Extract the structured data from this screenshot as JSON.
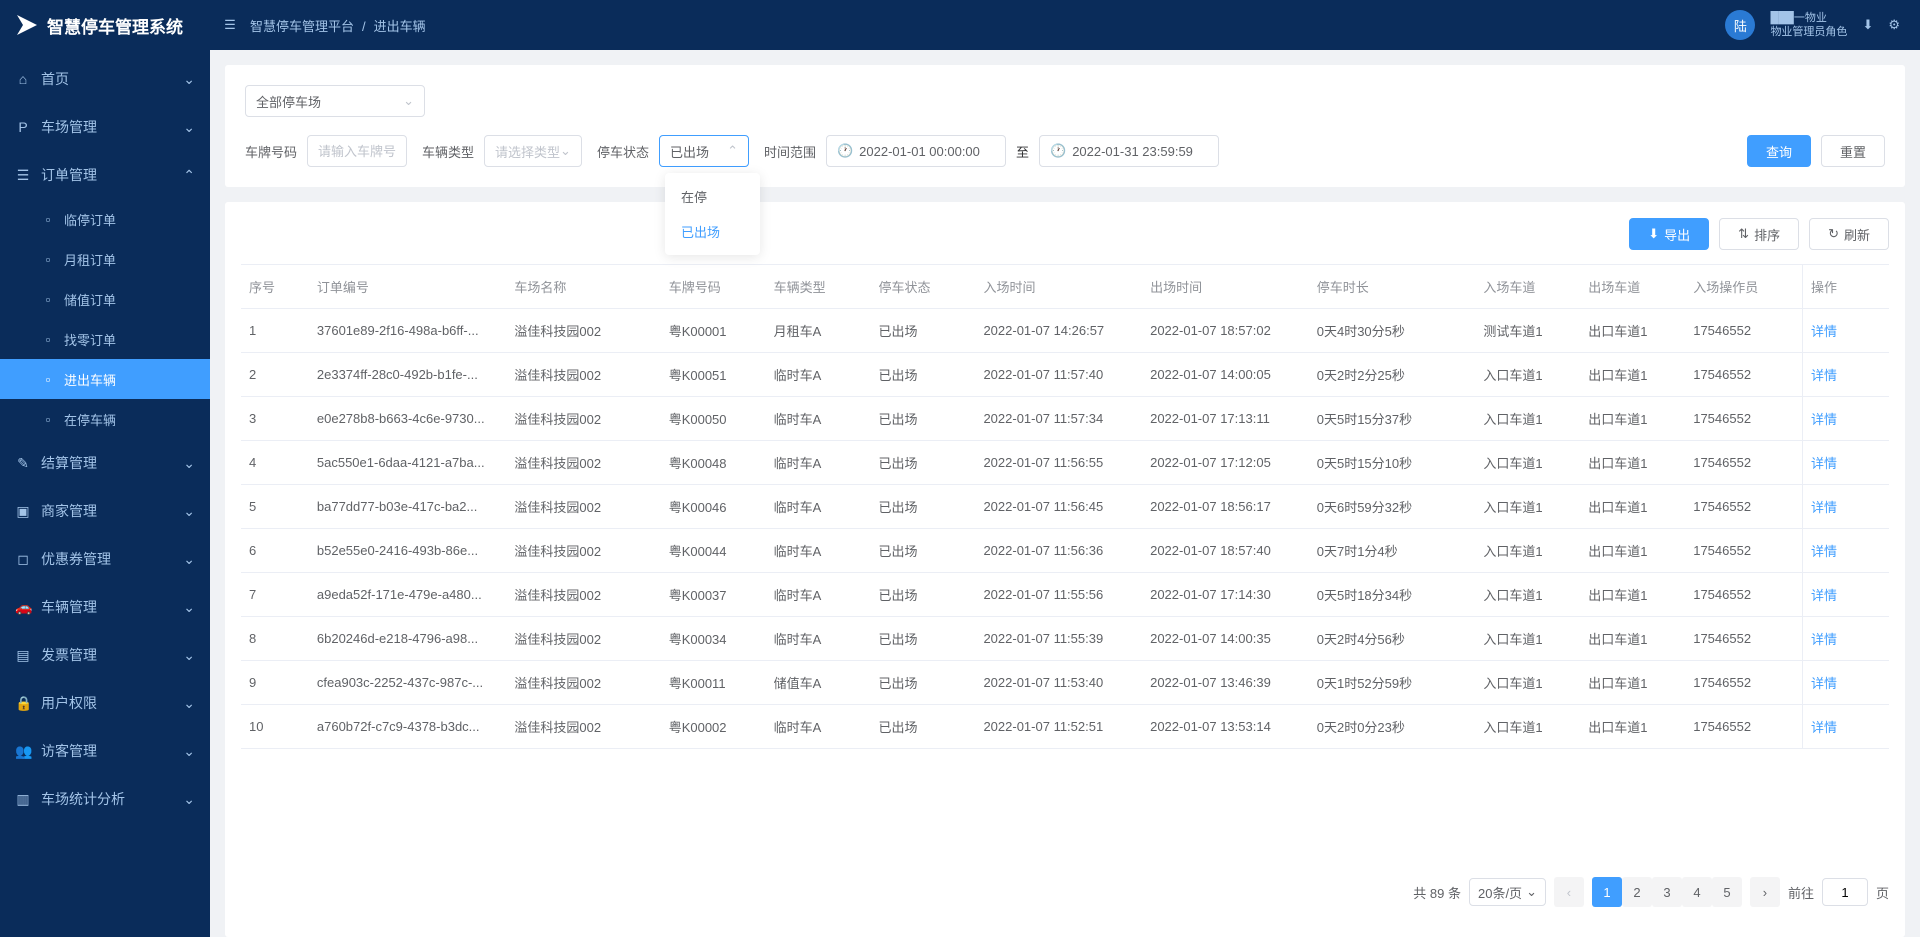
{
  "app": {
    "title": "智慧停车管理系统"
  },
  "breadcrumb": {
    "a": "智慧停车管理平台",
    "b": "进出车辆"
  },
  "user": {
    "avatar": "陆",
    "name": "███一物业",
    "role": "物业管理员角色"
  },
  "sidebar": {
    "items": [
      {
        "icon": "⌂",
        "label": "首页",
        "arrow": "⌄"
      },
      {
        "icon": "P",
        "label": "车场管理",
        "arrow": "⌄"
      },
      {
        "icon": "☰",
        "label": "订单管理",
        "arrow": "⌃",
        "open": true
      },
      {
        "icon": "✎",
        "label": "结算管理",
        "arrow": "⌄"
      },
      {
        "icon": "▣",
        "label": "商家管理",
        "arrow": "⌄"
      },
      {
        "icon": "◻",
        "label": "优惠券管理",
        "arrow": "⌄"
      },
      {
        "icon": "🚗",
        "label": "车辆管理",
        "arrow": "⌄"
      },
      {
        "icon": "▤",
        "label": "发票管理",
        "arrow": "⌄"
      },
      {
        "icon": "🔒",
        "label": "用户权限",
        "arrow": "⌄"
      },
      {
        "icon": "👥",
        "label": "访客管理",
        "arrow": "⌄"
      },
      {
        "icon": "▥",
        "label": "车场统计分析",
        "arrow": "⌄"
      }
    ],
    "subs": [
      {
        "label": "临停订单"
      },
      {
        "label": "月租订单"
      },
      {
        "label": "储值订单"
      },
      {
        "label": "找零订单"
      },
      {
        "label": "进出车辆",
        "active": true
      },
      {
        "label": "在停车辆"
      }
    ]
  },
  "filters": {
    "parking_lot": "全部停车场",
    "plate_label": "车牌号码",
    "plate_placeholder": "请输入车牌号",
    "type_label": "车辆类型",
    "type_placeholder": "请选择类型",
    "status_label": "停车状态",
    "status_value": "已出场",
    "time_label": "时间范围",
    "time_to": "至",
    "start_time": "2022-01-01 00:00:00",
    "end_time": "2022-01-31 23:59:59",
    "search_btn": "查询",
    "reset_btn": "重置",
    "dropdown": {
      "opt1": "在停",
      "opt2": "已出场"
    }
  },
  "toolbar": {
    "export": "导出",
    "sort": "排序",
    "refresh": "刷新"
  },
  "table": {
    "headers": [
      "序号",
      "订单编号",
      "车场名称",
      "车牌号码",
      "车辆类型",
      "停车状态",
      "入场时间",
      "出场时间",
      "停车时长",
      "入场车道",
      "出场车道",
      "入场操作员",
      "操作"
    ],
    "rows": [
      {
        "seq": "1",
        "id": "37601e89-2f16-498a-b6ff-...",
        "lot": "溢佳科技园002",
        "plate": "粤K00001",
        "type": "月租车A",
        "status": "已出场",
        "enter": "2022-01-07 14:26:57",
        "leave": "2022-01-07 18:57:02",
        "dur": "0天4时30分5秒",
        "in_lane": "测试车道1",
        "out_lane": "出口车道1",
        "op": "17546552"
      },
      {
        "seq": "2",
        "id": "2e3374ff-28c0-492b-b1fe-...",
        "lot": "溢佳科技园002",
        "plate": "粤K00051",
        "type": "临时车A",
        "status": "已出场",
        "enter": "2022-01-07 11:57:40",
        "leave": "2022-01-07 14:00:05",
        "dur": "0天2时2分25秒",
        "in_lane": "入口车道1",
        "out_lane": "出口车道1",
        "op": "17546552"
      },
      {
        "seq": "3",
        "id": "e0e278b8-b663-4c6e-9730...",
        "lot": "溢佳科技园002",
        "plate": "粤K00050",
        "type": "临时车A",
        "status": "已出场",
        "enter": "2022-01-07 11:57:34",
        "leave": "2022-01-07 17:13:11",
        "dur": "0天5时15分37秒",
        "in_lane": "入口车道1",
        "out_lane": "出口车道1",
        "op": "17546552"
      },
      {
        "seq": "4",
        "id": "5ac550e1-6daa-4121-a7ba...",
        "lot": "溢佳科技园002",
        "plate": "粤K00048",
        "type": "临时车A",
        "status": "已出场",
        "enter": "2022-01-07 11:56:55",
        "leave": "2022-01-07 17:12:05",
        "dur": "0天5时15分10秒",
        "in_lane": "入口车道1",
        "out_lane": "出口车道1",
        "op": "17546552"
      },
      {
        "seq": "5",
        "id": "ba77dd77-b03e-417c-ba2...",
        "lot": "溢佳科技园002",
        "plate": "粤K00046",
        "type": "临时车A",
        "status": "已出场",
        "enter": "2022-01-07 11:56:45",
        "leave": "2022-01-07 18:56:17",
        "dur": "0天6时59分32秒",
        "in_lane": "入口车道1",
        "out_lane": "出口车道1",
        "op": "17546552"
      },
      {
        "seq": "6",
        "id": "b52e55e0-2416-493b-86e...",
        "lot": "溢佳科技园002",
        "plate": "粤K00044",
        "type": "临时车A",
        "status": "已出场",
        "enter": "2022-01-07 11:56:36",
        "leave": "2022-01-07 18:57:40",
        "dur": "0天7时1分4秒",
        "in_lane": "入口车道1",
        "out_lane": "出口车道1",
        "op": "17546552"
      },
      {
        "seq": "7",
        "id": "a9eda52f-171e-479e-a480...",
        "lot": "溢佳科技园002",
        "plate": "粤K00037",
        "type": "临时车A",
        "status": "已出场",
        "enter": "2022-01-07 11:55:56",
        "leave": "2022-01-07 17:14:30",
        "dur": "0天5时18分34秒",
        "in_lane": "入口车道1",
        "out_lane": "出口车道1",
        "op": "17546552"
      },
      {
        "seq": "8",
        "id": "6b20246d-e218-4796-a98...",
        "lot": "溢佳科技园002",
        "plate": "粤K00034",
        "type": "临时车A",
        "status": "已出场",
        "enter": "2022-01-07 11:55:39",
        "leave": "2022-01-07 14:00:35",
        "dur": "0天2时4分56秒",
        "in_lane": "入口车道1",
        "out_lane": "出口车道1",
        "op": "17546552"
      },
      {
        "seq": "9",
        "id": "cfea903c-2252-437c-987c-...",
        "lot": "溢佳科技园002",
        "plate": "粤K00011",
        "type": "储值车A",
        "status": "已出场",
        "enter": "2022-01-07 11:53:40",
        "leave": "2022-01-07 13:46:39",
        "dur": "0天1时52分59秒",
        "in_lane": "入口车道1",
        "out_lane": "出口车道1",
        "op": "17546552"
      },
      {
        "seq": "10",
        "id": "a760b72f-c7c9-4378-b3dc...",
        "lot": "溢佳科技园002",
        "plate": "粤K00002",
        "type": "临时车A",
        "status": "已出场",
        "enter": "2022-01-07 11:52:51",
        "leave": "2022-01-07 13:53:14",
        "dur": "0天2时0分23秒",
        "in_lane": "入口车道1",
        "out_lane": "出口车道1",
        "op": "17546552"
      }
    ],
    "detail_link": "详情"
  },
  "pagination": {
    "total": "共 89 条",
    "page_size": "20条/页",
    "pages": [
      "1",
      "2",
      "3",
      "4",
      "5"
    ],
    "goto_prefix": "前往",
    "goto_value": "1",
    "goto_suffix": "页"
  }
}
